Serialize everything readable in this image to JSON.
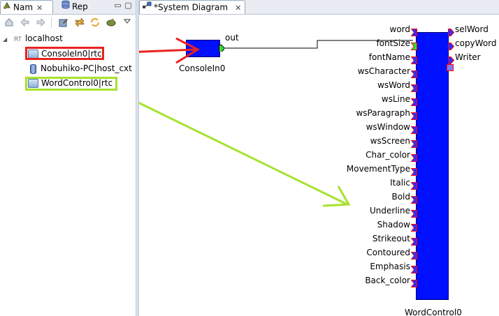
{
  "left_view": {
    "tabs": [
      {
        "label": "Nam",
        "icon": "name-service-icon",
        "active": true
      },
      {
        "label": "Rep",
        "icon": "repository-icon",
        "active": false
      }
    ],
    "close_glyph": "✕",
    "minimize_glyph": "▭",
    "maximize_glyph": "▢",
    "toolbar": [
      "home-icon",
      "back-icon",
      "forward-icon",
      "edit-icon",
      "connect-icon",
      "refresh-icon",
      "tool-icon",
      "view-menu-icon"
    ],
    "tree": {
      "root": {
        "label": "localhost",
        "prefix": "RT"
      },
      "children": [
        {
          "label": "ConsoleIn0|rtc",
          "type": "rtc"
        },
        {
          "label": "Nobuhiko-PC|host_cxt",
          "type": "context"
        },
        {
          "label": "WordControl0|rtc",
          "type": "rtc"
        }
      ]
    }
  },
  "editor": {
    "tab": {
      "label": "*System Diagram",
      "icon": "system-diagram-icon"
    },
    "consolein": {
      "name": "ConsoleIn0",
      "out_port": "out"
    },
    "wordcontrol": {
      "name": "WordControl0",
      "in_ports": [
        "word",
        "fontSize",
        "fontName",
        "wsCharacter",
        "wsWord",
        "wsLine",
        "wsParagraph",
        "wsWindow",
        "wsScreen",
        "Char_color",
        "MovementType",
        "Italic",
        "Bold",
        "Underline",
        "Shadow",
        "Strikeout",
        "Contoured",
        "Emphasis",
        "Back_color"
      ],
      "out_ports": [
        "selWord",
        "copyWord",
        "Writer"
      ]
    },
    "colors": {
      "component": "#0010ff",
      "in_port": "#3030ff",
      "out_port": "#30e030",
      "port_border": "#ff0000",
      "arrow_red": "#e8231f",
      "arrow_green": "#a6e22e"
    }
  }
}
